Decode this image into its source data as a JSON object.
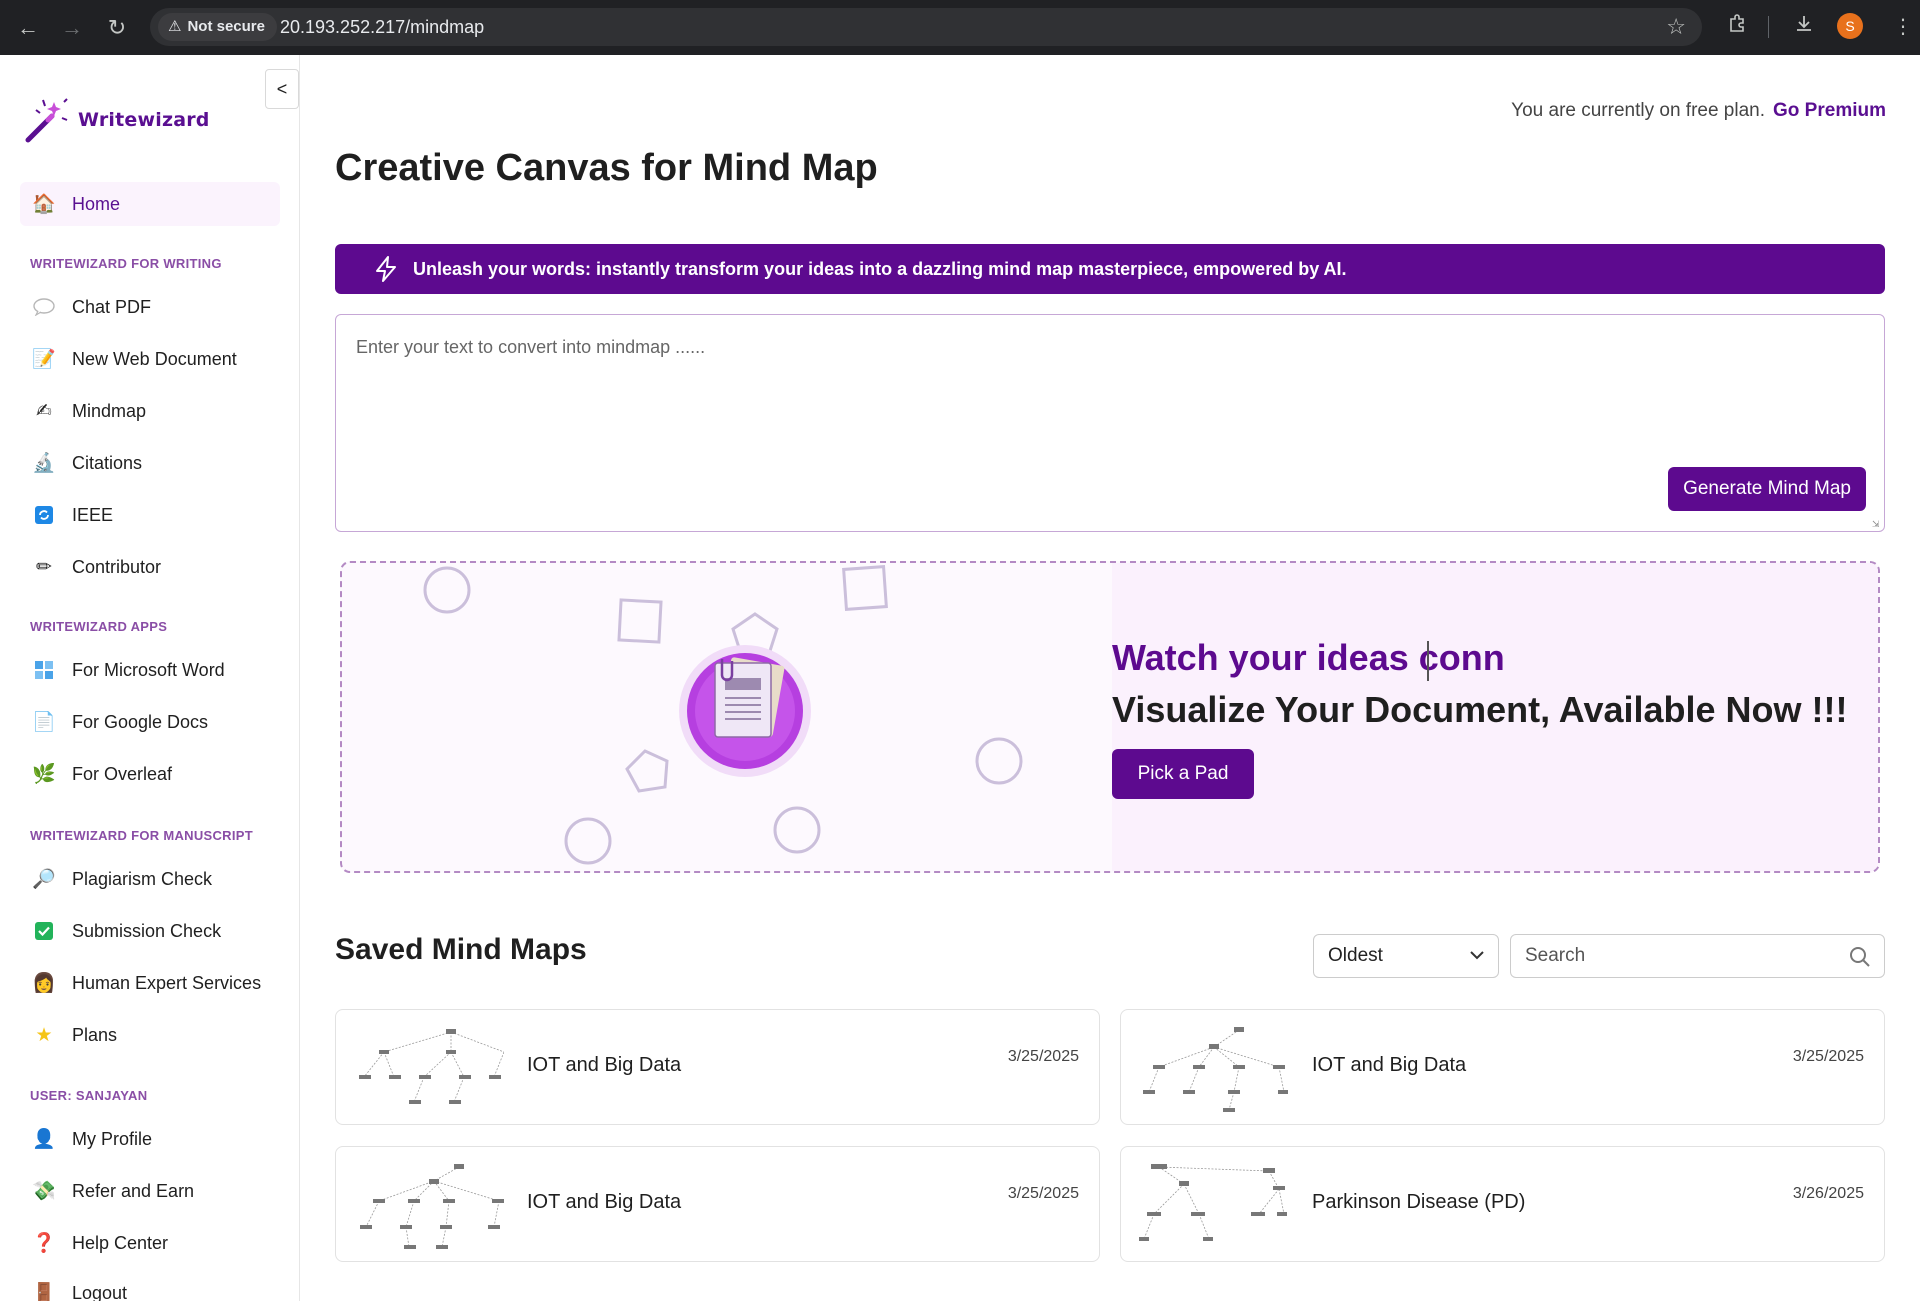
{
  "browser": {
    "security_label": "Not secure",
    "url": "20.193.252.217/mindmap",
    "profile_initial": "S"
  },
  "sidebar": {
    "collapse_label": "<",
    "brand": "Writewizard",
    "home": "Home",
    "sections": {
      "writing": "WRITEWIZARD FOR WRITING",
      "apps": "WRITEWIZARD APPS",
      "manuscript": "WRITEWIZARD FOR MANUSCRIPT",
      "user": "USER: SANJAYAN"
    },
    "writing_items": [
      "Chat PDF",
      "New Web Document",
      "Mindmap",
      "Citations",
      "IEEE",
      "Contributor"
    ],
    "app_items": [
      "For Microsoft Word",
      "For Google Docs",
      "For Overleaf"
    ],
    "manuscript_items": [
      "Plagiarism Check",
      "Submission Check",
      "Human Expert Services",
      "Plans"
    ],
    "user_items": [
      "My Profile",
      "Refer and Earn",
      "Help Center",
      "Logout"
    ]
  },
  "header": {
    "plan_text": "You are currently on free plan.",
    "premium_link": "Go Premium"
  },
  "main": {
    "title": "Creative Canvas for Mind Map",
    "banner": "Unleash your words: instantly transform your ideas into a dazzling mind map masterpiece, empowered by AI.",
    "input_placeholder": "Enter your text to convert into mindmap ......",
    "generate_button": "Generate Mind Map",
    "promo": {
      "heading_typing": "Watch your ideas conn",
      "heading": "Visualize Your Document, Available Now !!!",
      "button": "Pick a Pad"
    },
    "saved": {
      "title": "Saved Mind Maps",
      "sort_selected": "Oldest",
      "search_placeholder": "Search",
      "cards": [
        {
          "title": "IOT and Big Data",
          "date": "3/25/2025"
        },
        {
          "title": "IOT and Big Data",
          "date": "3/25/2025"
        },
        {
          "title": "IOT and Big Data",
          "date": "3/25/2025"
        },
        {
          "title": "Parkinson Disease (PD)",
          "date": "3/26/2025"
        }
      ]
    }
  },
  "colors": {
    "brand": "#5d0a8f",
    "brand_light": "#fbf3fd",
    "section_label": "#8a4ea6",
    "chrome_bg": "#202124"
  },
  "icons": {
    "home": "home-icon",
    "chat_pdf": "speech-bubble-icon",
    "new_web_document": "memo-icon",
    "mindmap": "writing-hand-icon",
    "citations": "microscope-icon",
    "ieee": "ieee-icon",
    "contributor": "pencil-icon",
    "word": "word-icon",
    "google_docs": "document-icon",
    "overleaf": "leaf-icon",
    "plagiarism": "magnifier-icon",
    "submission": "checkbox-icon",
    "expert": "expert-icon",
    "plans": "star-icon",
    "profile": "user-icon",
    "refer": "money-icon",
    "help": "question-icon",
    "logout": "door-icon"
  }
}
